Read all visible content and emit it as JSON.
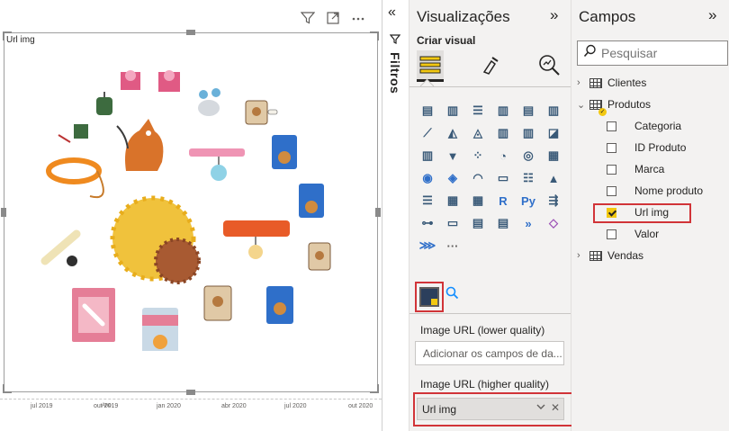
{
  "visual": {
    "title": "Url img",
    "header_icons": [
      "filter-icon",
      "focus-mode-icon",
      "more-options-icon"
    ],
    "x_axis": {
      "ticks": [
        "jul 2019",
        "out 2019",
        "jan 2020",
        "abr 2020",
        "jul 2020",
        "out 2020"
      ],
      "title": "Ano"
    },
    "images": [
      "bow-icon",
      "bow-icon",
      "bird-cage-icon",
      "mouse-toy-icon",
      "cat-food-bag-icon",
      "trophy-icon",
      "dog-icon",
      "leash-icon",
      "cat-food-can-icon",
      "collar-icon",
      "cat-collar-icon",
      "dog-food-bag-icon",
      "yellow-ball-icon",
      "brown-ball-icon",
      "bone-icon",
      "red-collar-icon",
      "cat-food-bag-icon",
      "treat-box-icon",
      "dog-food-bag-icon",
      "cat-food-bag-icon",
      "canned-food-icon"
    ]
  },
  "filters": {
    "label": "Filtros"
  },
  "visualizations": {
    "title": "Visualizações",
    "subtitle": "Criar visual",
    "chart_icons": [
      "stacked-bar-icon",
      "stacked-column-icon",
      "clustered-bar-icon",
      "clustered-column-icon",
      "100-bar-icon",
      "100-column-icon",
      "line-chart-icon",
      "area-chart-icon",
      "stacked-area-icon",
      "line-column-icon",
      "line-clustered-icon",
      "ribbon-chart-icon",
      "waterfall-icon",
      "funnel-icon",
      "scatter-icon",
      "pie-icon",
      "donut-icon",
      "treemap-icon",
      "map-icon",
      "filled-map-icon",
      "gauge-icon",
      "card-icon",
      "multirow-card-icon",
      "kpi-icon",
      "slicer-icon",
      "table-icon",
      "matrix-icon",
      "r-visual-icon",
      "python-visual-icon",
      "key-influencers-icon",
      "decomposition-tree-icon",
      "qa-icon",
      "narrative-icon",
      "paginated-report-icon",
      "power-automate-icon",
      "power-apps-icon",
      "arcgis-icon",
      "more-visuals-icon"
    ],
    "selected_visual": "image-grid-icon",
    "wells": {
      "low_label": "Image URL (lower quality)",
      "low_placeholder": "Adicionar os campos de da...",
      "high_label": "Image URL (higher quality)",
      "high_value": "Url img"
    }
  },
  "fields": {
    "title": "Campos",
    "search_placeholder": "Pesquisar",
    "tables": [
      {
        "name": "Clientes",
        "expanded": false
      },
      {
        "name": "Produtos",
        "expanded": true,
        "columns": [
          {
            "name": "Categoria",
            "checked": false
          },
          {
            "name": "ID Produto",
            "checked": false
          },
          {
            "name": "Marca",
            "checked": false
          },
          {
            "name": "Nome produto",
            "checked": false
          },
          {
            "name": "Url img",
            "checked": true
          },
          {
            "name": "Valor",
            "checked": false
          }
        ]
      },
      {
        "name": "Vendas",
        "expanded": false
      }
    ]
  },
  "colors": {
    "highlight": "#d13438",
    "accent": "#f2c811",
    "pane_bg": "#f3f2f1"
  }
}
